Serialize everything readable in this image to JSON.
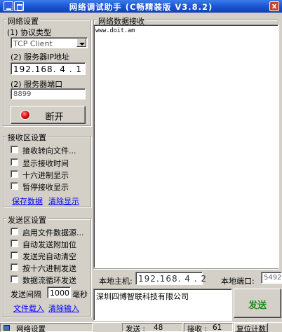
{
  "window": {
    "title": "网络调试助手 (C畅精装版 V3.8.2)",
    "close_glyph": "x"
  },
  "network_settings": {
    "title": "网络设置",
    "protocol_label": "(1) 协议类型",
    "protocol_value": "TCP Client",
    "server_ip_label": "(2) 服务器IP地址",
    "server_ip_value": "192.168. 4 . 1",
    "server_port_label": "(2) 服务器端口",
    "server_port_value": "8899",
    "connect_button": "断开",
    "connected": true
  },
  "receive_settings": {
    "title": "接收区设置",
    "options": [
      "接收转向文件...",
      "显示接收时间",
      "十六进制显示",
      "暂停接收显示"
    ],
    "save_link": "保存数据",
    "clear_link": "清除显示"
  },
  "send_settings": {
    "title": "发送区设置",
    "options": [
      "启用文件数据源...",
      "自动发送附加位",
      "发送完自动清空",
      "按十六进制发送",
      "数据流循环发送"
    ],
    "interval_label": "发送间隔",
    "interval_value": "1000",
    "interval_unit": "毫秒",
    "file_link": "文件载入",
    "clear_link": "清除输入"
  },
  "receive_area": {
    "title": "网络数据接收",
    "content": "www.doit.am"
  },
  "local": {
    "host_label": "本地主机:",
    "host_value": "192.168. 4 . 2",
    "port_label": "本地端口:",
    "port_value": "5492"
  },
  "send_area": {
    "content": "深圳四博智联科技有限公司",
    "send_button": "发送"
  },
  "status": {
    "indicator": "网络设置",
    "sent_label": "发送 :",
    "sent_value": "48",
    "received_label": "接收 :",
    "received_value": "61",
    "reset_button": "复位计数"
  },
  "colors": {
    "led": "#e01010",
    "title_bar": "#1b56d6",
    "link": "#0000ff"
  }
}
